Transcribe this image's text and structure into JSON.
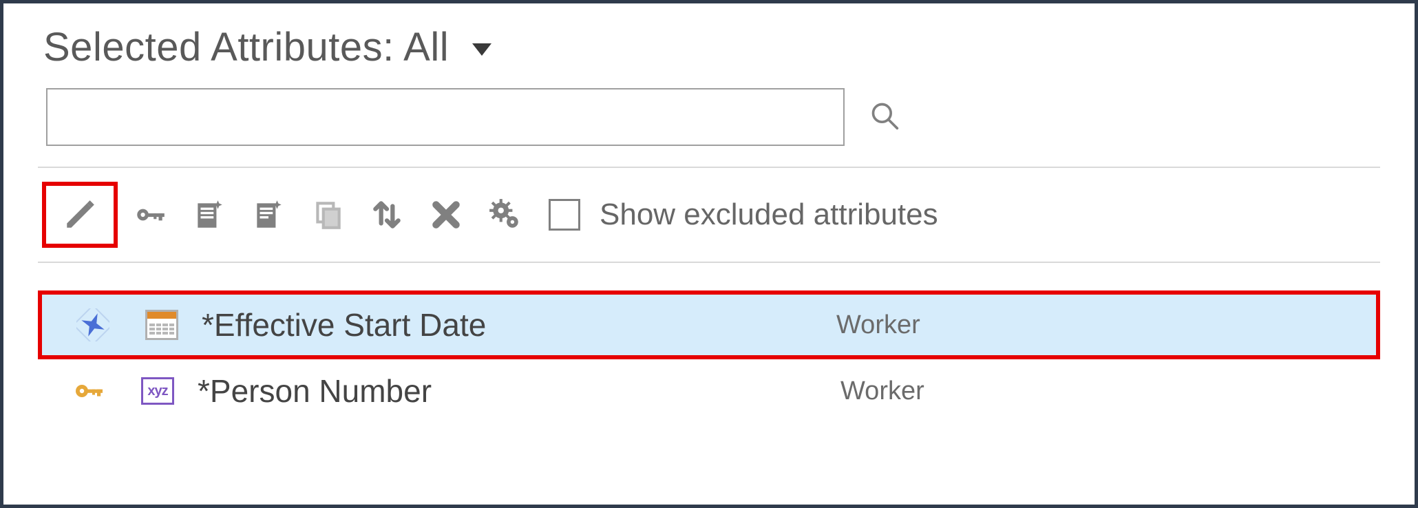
{
  "header": {
    "title": "Selected Attributes: All"
  },
  "search": {
    "value": "",
    "placeholder": ""
  },
  "toolbar": {
    "show_excluded_label": "Show excluded attributes"
  },
  "icons": {
    "edit": "pencil-icon",
    "key": "key-icon",
    "doc_star1": "document-new-1-icon",
    "doc_star2": "document-new-2-icon",
    "copy": "copy-icon",
    "sort": "sort-arrows-icon",
    "remove": "remove-x-icon",
    "settings": "gear-settings-icon",
    "search": "search-icon"
  },
  "rows": [
    {
      "badge": "required-star-icon",
      "type_icon": "calendar-icon",
      "name": "*Effective Start Date",
      "source": "Worker",
      "selected": true
    },
    {
      "badge": "key-gold-icon",
      "type_icon": "text-xyz-icon",
      "name": "*Person Number",
      "source": "Worker",
      "selected": false
    }
  ],
  "colors": {
    "highlight": "#e60000",
    "row_selected_bg": "#d6ecfb",
    "text_primary": "#595959",
    "icon_gray": "#808080"
  }
}
